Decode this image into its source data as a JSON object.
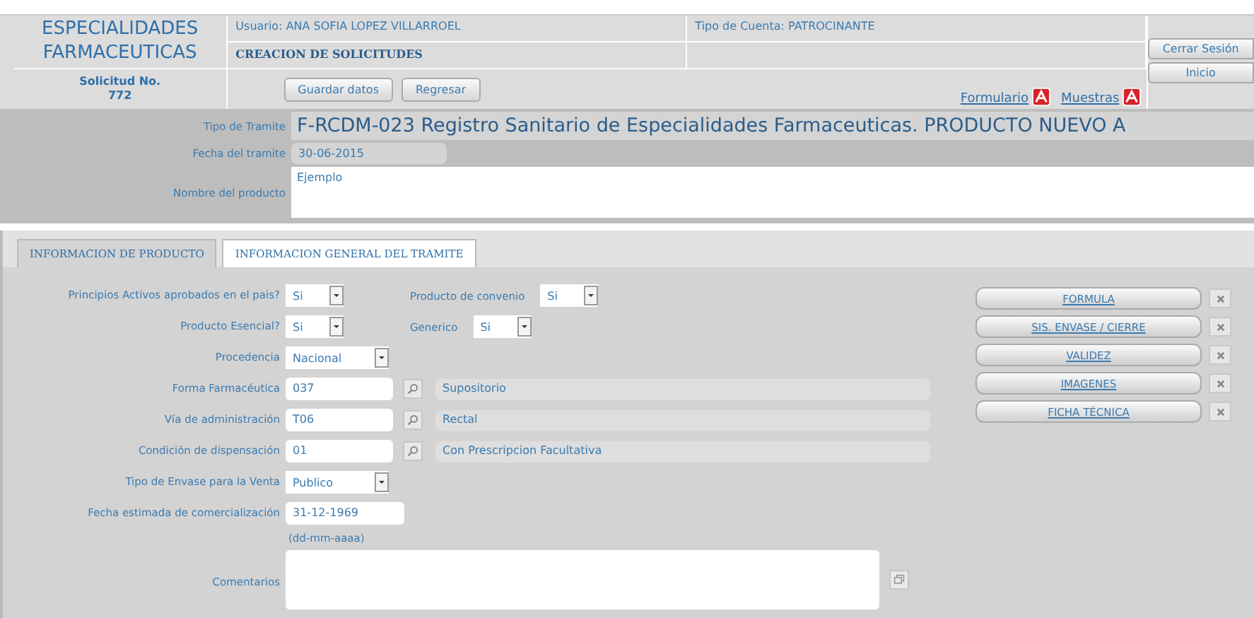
{
  "header": {
    "title": "ESPECIALIDADES FARMACEUTICAS",
    "user": "Usuario: ANA SOFIA LOPEZ VILLARROEL",
    "account": "Tipo de Cuenta: PATROCINANTE",
    "section": "CREACION DE SOLICITUDES",
    "request_label": "Solicitud No.",
    "request_number": "772",
    "buttons": [
      "Guardar datos",
      "Regresar"
    ],
    "links": [
      "Formulario",
      "Muestras"
    ],
    "side_buttons": [
      "Cerrar Sesión",
      "Inicio"
    ]
  },
  "tramite": {
    "type_label": "Tipo de Tramite",
    "type_value": "F-RCDM-023 Registro Sanitario de Especialidades Farmaceuticas. PRODUCTO NUEVO A",
    "date_label": "Fecha del tramite",
    "date_value": "30-06-2015",
    "name_label": "Nombre del producto",
    "name_value": "Ejemplo"
  },
  "tabs": [
    {
      "label": "INFORMACION DE PRODUCTO",
      "selected": true
    },
    {
      "label": "INFORMACION GENERAL DEL TRAMITE",
      "selected": false
    }
  ],
  "form": [
    {
      "kind": "select-pair",
      "label": "Principios Activos aprobados en el pais?",
      "value": "Si",
      "pair_label": "Producto de convenio",
      "pair_value": "Si"
    },
    {
      "kind": "select-pair",
      "label": "Producto Esencial?",
      "value": "Si",
      "pair_label": "Generico",
      "pair_value": "Si"
    },
    {
      "kind": "select",
      "label": "Procedencia",
      "value": "Nacional"
    },
    {
      "kind": "lookup",
      "label": "Forma Farmacéutica",
      "value": "037",
      "description": "Supositorio"
    },
    {
      "kind": "lookup",
      "label": "Vía de administración",
      "value": "T06",
      "description": "Rectal"
    },
    {
      "kind": "lookup",
      "label": "Condición de dispensación",
      "value": "01",
      "description": "Con Prescripcion Facultativa"
    },
    {
      "kind": "select",
      "label": "Tipo de Envase para la Venta",
      "value": "Publico"
    },
    {
      "kind": "date",
      "label": "Fecha estimada de comercialización",
      "value": "31-12-1969",
      "hint": "(dd-mm-aaaa)"
    },
    {
      "kind": "textarea",
      "label": "Comentarios"
    }
  ],
  "actions": [
    "FORMULA",
    "SIS. ENVASE / CIERRE",
    "VALIDEZ",
    "IMAGENES",
    "FICHA TÉCNICA"
  ]
}
